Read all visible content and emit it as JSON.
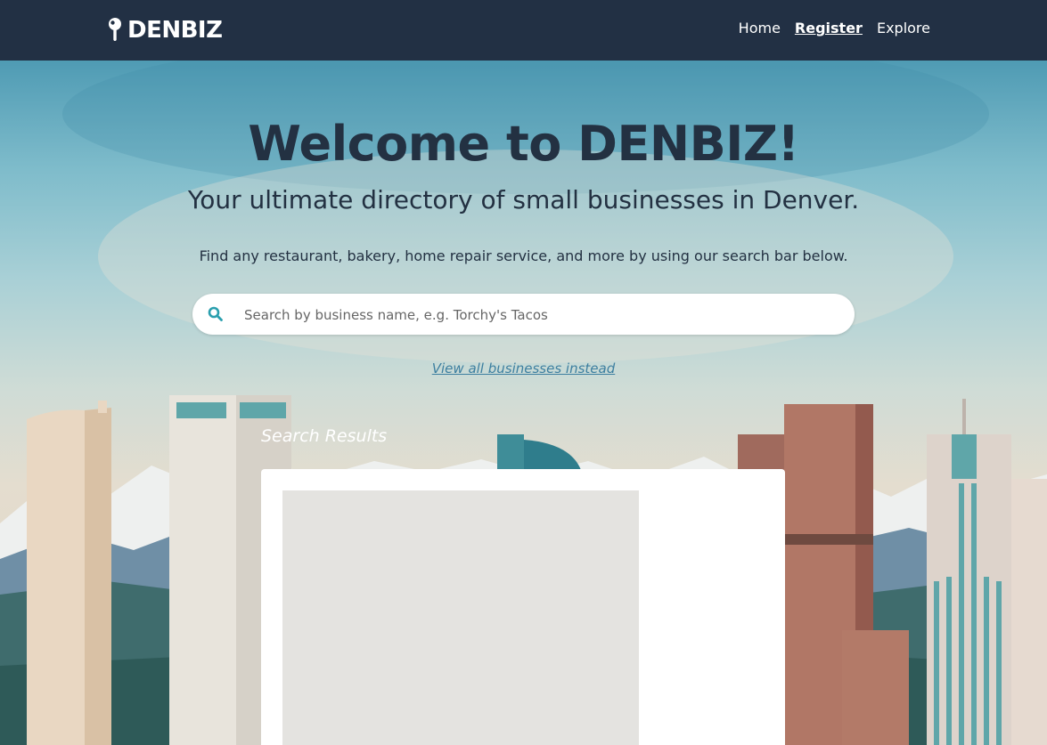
{
  "brand": {
    "name": "DENBIZ",
    "icon": "map-pin-icon"
  },
  "nav": {
    "home": "Home",
    "register": "Register",
    "explore": "Explore"
  },
  "hero": {
    "title": "Welcome to DENBIZ!",
    "subtitle": "Your ultimate directory of small businesses in Denver.",
    "description": "Find any restaurant, bakery, home repair service, and more by using our search bar below."
  },
  "search": {
    "icon": "search-icon",
    "placeholder": "Search by business name, e.g. Torchy's Tacos",
    "value": ""
  },
  "view_all": "View all businesses instead",
  "results": {
    "title": "Search Results"
  },
  "colors": {
    "navbar": "#223044",
    "heading": "#233142",
    "accent": "#2a9fae",
    "link": "#3d7fa0"
  }
}
